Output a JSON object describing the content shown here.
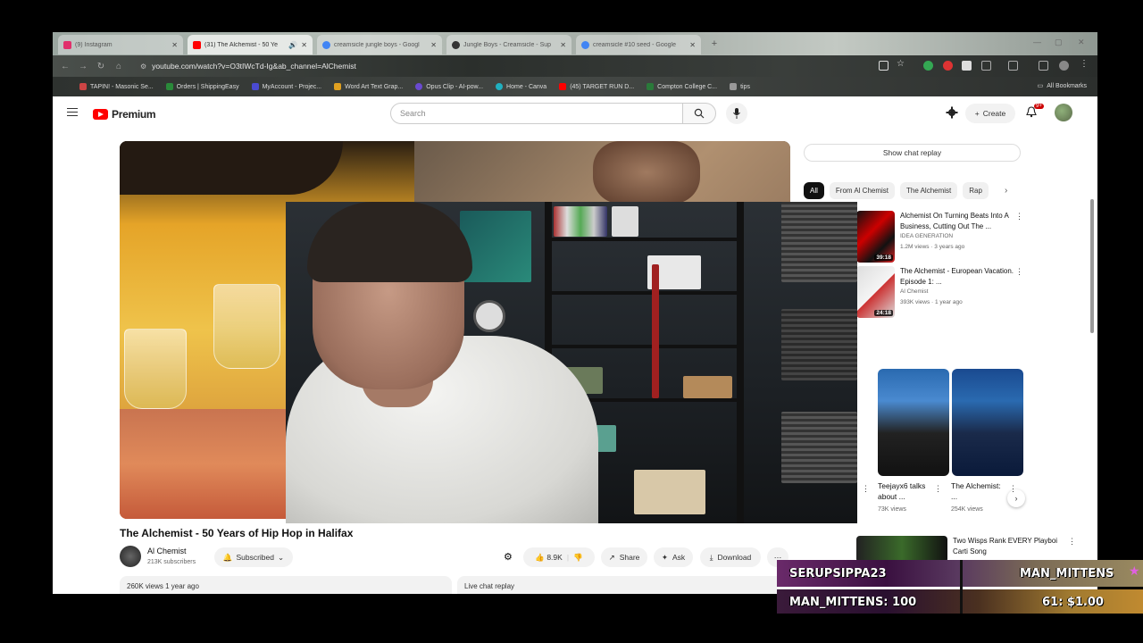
{
  "browser": {
    "tabs": [
      {
        "label": "(9) Instagram",
        "color": "#e1306c",
        "active": false
      },
      {
        "label": "(31) The Alchemist - 50 Ye",
        "color": "#ff0000",
        "active": true
      },
      {
        "label": "creamsicle jungle boys - Googl",
        "color": "#4285f4",
        "active": false
      },
      {
        "label": "Jungle Boys - Creamsicle - Sup",
        "color": "#333333",
        "active": false
      },
      {
        "label": "creamsicle #10 seed - Google",
        "color": "#4285f4",
        "active": false
      }
    ],
    "url": "youtube.com/watch?v=O3tIWcTd-Ig&ab_channel=AlChemist",
    "bookmarks": [
      "TAPIN! - Masonic Se...",
      "Orders | ShippingEasy",
      "MyAccount - Projec...",
      "Word Art Text Grap...",
      "Opus Clip - AI-pow...",
      "Home - Canva",
      "(45) TARGET RUN D...",
      "Compton College C...",
      "tips"
    ],
    "all_bookmarks": "All Bookmarks"
  },
  "youtube": {
    "logo_text": "Premium",
    "search_placeholder": "Search",
    "create_label": "Create",
    "notif_count": "9+",
    "video_title": "The Alchemist - 50 Years of Hip Hop in Halifax",
    "channel_name": "Al Chemist",
    "channel_subs": "213K subscribers",
    "subscribed_label": "Subscribed",
    "like_count": "8.9K",
    "share_label": "Share",
    "ask_label": "Ask",
    "download_label": "Download",
    "views_line": "260K views  1 year ago",
    "chat_replay_strip": "Live chat replay",
    "show_chat_replay": "Show chat replay",
    "chips": [
      "All",
      "From Al Chemist",
      "The Alchemist",
      "Rap"
    ],
    "recommendations": [
      {
        "title": "Alchemist On Turning Beats Into A Business, Cutting Out The ...",
        "channel": "IDEA GENERATION",
        "meta": "1.2M views · 3 years ago",
        "duration": "39:18"
      },
      {
        "title": "The Alchemist - European Vacation. Episode 1: ...",
        "channel": "Al Chemist",
        "meta": "393K views · 1 year ago",
        "duration": "24:18"
      },
      {
        "title": "Two Wisps Rank EVERY Playboi Carti Song",
        "channel": "",
        "meta": "",
        "duration": ""
      }
    ],
    "shorts": [
      {
        "title": "Teejayx6 talks about ...",
        "views": "73K views"
      },
      {
        "title": "The Alchemist: ...",
        "views": "254K views"
      }
    ]
  },
  "stream_overlay": {
    "top_left": "SERUPSIPPA23",
    "top_right": "MAN_MITTENS",
    "bottom_left": "MAN_MITTENS: 100",
    "bottom_right": "61: $1.00"
  }
}
